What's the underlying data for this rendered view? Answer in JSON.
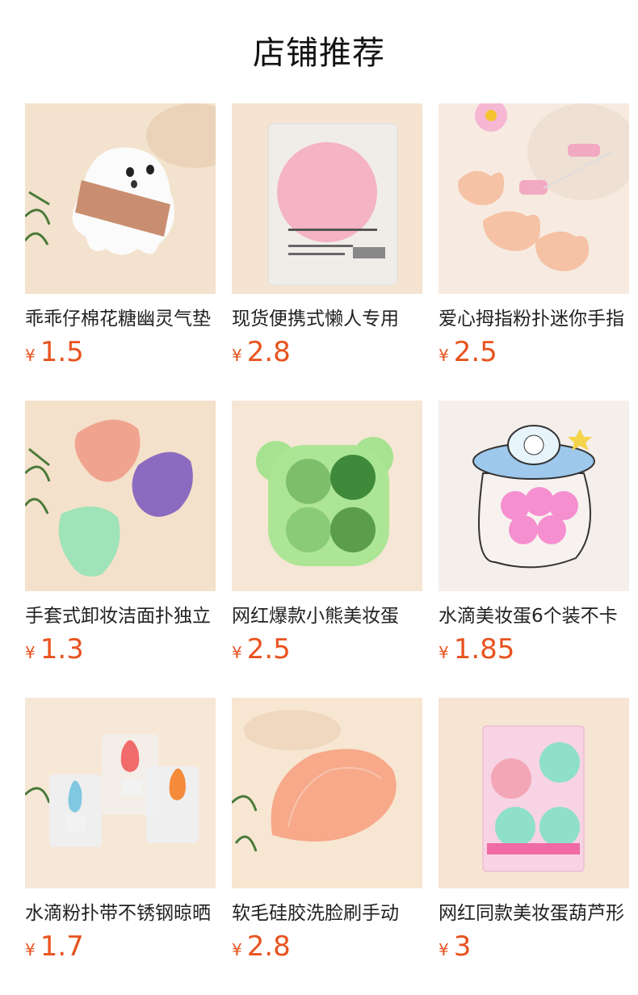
{
  "page_title": "店铺推荐",
  "currency_symbol": "¥",
  "price_color": "#e8531f",
  "products": [
    {
      "name": "乖乖仔棉花糖幽灵气垫",
      "price": "1.5"
    },
    {
      "name": "现货便携式懒人专用",
      "price": "2.8"
    },
    {
      "name": "爱心拇指粉扑迷你手指",
      "price": "2.5"
    },
    {
      "name": "手套式卸妆洁面扑独立",
      "price": "1.3"
    },
    {
      "name": "网红爆款小熊美妆蛋",
      "price": "2.5"
    },
    {
      "name": "水滴美妆蛋6个装不卡",
      "price": "1.85"
    },
    {
      "name": "水滴粉扑带不锈钢晾晒",
      "price": "1.7"
    },
    {
      "name": "软毛硅胶洗脸刷手动",
      "price": "2.8"
    },
    {
      "name": "网红同款美妆蛋葫芦形",
      "price": "3"
    }
  ]
}
